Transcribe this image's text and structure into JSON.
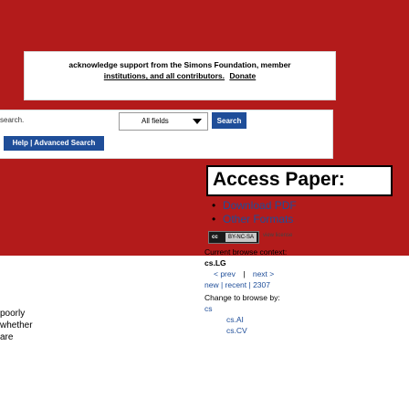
{
  "header": {
    "ack_line1": "acknowledge support from the Simons Foundation, member",
    "ack_line2_links": "institutions, and all contributors.",
    "ack_line2_donate": "Donate",
    "search_fragment": "search.",
    "field_select": "All fields",
    "search_button": "Search",
    "advanced_link": "Help | Advanced Search"
  },
  "sidebar": {
    "access_title": "Access Paper:",
    "links": [
      "Download PDF",
      "Other Formats"
    ],
    "license_badge": "BY-NC-SA",
    "view_license": "view license",
    "browse_context_label": "Current browse context:",
    "browse_context": "cs.LG",
    "prev": "< prev",
    "sep": "|",
    "next": "next >",
    "new_recent": "new | recent | 2307",
    "change_browse": "Change to browse by:",
    "browse_cs": "cs",
    "browse_ai": "cs.AI",
    "browse_cv": "cs.CV"
  },
  "main_fragments": [
    "poorly",
    "whether",
    "are"
  ]
}
